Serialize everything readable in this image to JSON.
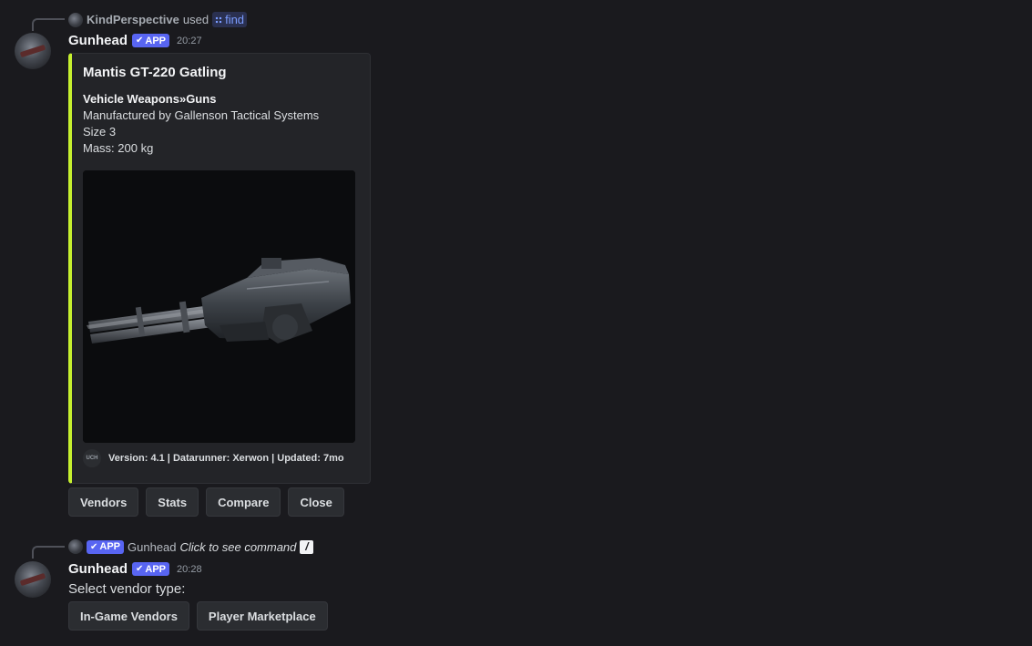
{
  "message1": {
    "reply": {
      "user": "KindPerspective",
      "used_text": "used",
      "command": "find"
    },
    "author": "Gunhead",
    "badge": "APP",
    "timestamp": "20:27",
    "embed": {
      "accent_color": "#c6f02f",
      "title": "Mantis GT-220 Gatling",
      "category": "Vehicle Weapons»Guns",
      "manufacturer_line": "Manufactured by Gallenson Tactical Systems",
      "size_line": "Size 3",
      "mass_line": "Mass: 200 kg",
      "footer_icon_text": "UCH",
      "footer": "Version: 4.1 | Datarunner: Xerwon | Updated: 7mo"
    },
    "buttons": [
      "Vendors",
      "Stats",
      "Compare",
      "Close"
    ]
  },
  "message2": {
    "reply": {
      "badge": "APP",
      "user": "Gunhead",
      "click_text": "Click to see command"
    },
    "author": "Gunhead",
    "badge": "APP",
    "timestamp": "20:28",
    "text": "Select vendor type:",
    "buttons": [
      "In-Game Vendors",
      "Player Marketplace"
    ]
  },
  "colors": {
    "background": "#1a1a1e",
    "app_badge": "#5865f2",
    "command_link": "#7b9cff"
  }
}
